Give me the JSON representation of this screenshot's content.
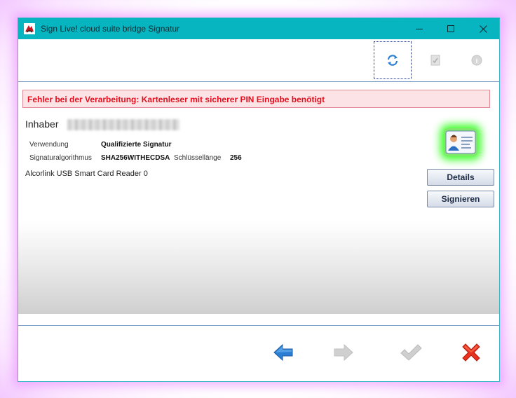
{
  "window": {
    "title": "Sign Live! cloud suite bridge Signatur"
  },
  "titlebar": {
    "minimize_icon": "minimize-icon",
    "maximize_icon": "maximize-icon",
    "close_icon": "close-icon",
    "color": "#07b5c1"
  },
  "toolbar": {
    "items": [
      {
        "name": "refresh",
        "icon": "refresh-icon",
        "state": "focused"
      },
      {
        "name": "document",
        "icon": "document-check-icon",
        "state": "disabled"
      },
      {
        "name": "info",
        "icon": "info-circle-icon",
        "state": "disabled"
      }
    ]
  },
  "error": {
    "message": "Fehler bei der Verarbeitung: Kartenleser mit sicherer PIN Eingabe benötigt",
    "color": "#e4101e"
  },
  "certificate": {
    "owner_label": "Inhaber",
    "usage_label": "Verwendung",
    "usage_value": "Qualifizierte Signatur",
    "algorithm_label": "Signaturalgorithmus",
    "algorithm_value": "SHA256WITHECDSA",
    "keylength_label": "Schlüssellänge",
    "keylength_value": "256",
    "reader": "Alcorlink USB Smart Card Reader 0"
  },
  "buttons": {
    "details": "Details",
    "sign": "Signieren"
  },
  "footer": {
    "items": [
      {
        "name": "back",
        "icon": "arrow-left-icon",
        "state": "enabled",
        "color": "#2a7fd4"
      },
      {
        "name": "forward",
        "icon": "arrow-right-icon",
        "state": "disabled"
      },
      {
        "name": "ok",
        "icon": "checkmark-icon",
        "state": "disabled"
      },
      {
        "name": "cancel",
        "icon": "red-x-icon",
        "state": "enabled",
        "color": "#e8321e"
      }
    ]
  }
}
